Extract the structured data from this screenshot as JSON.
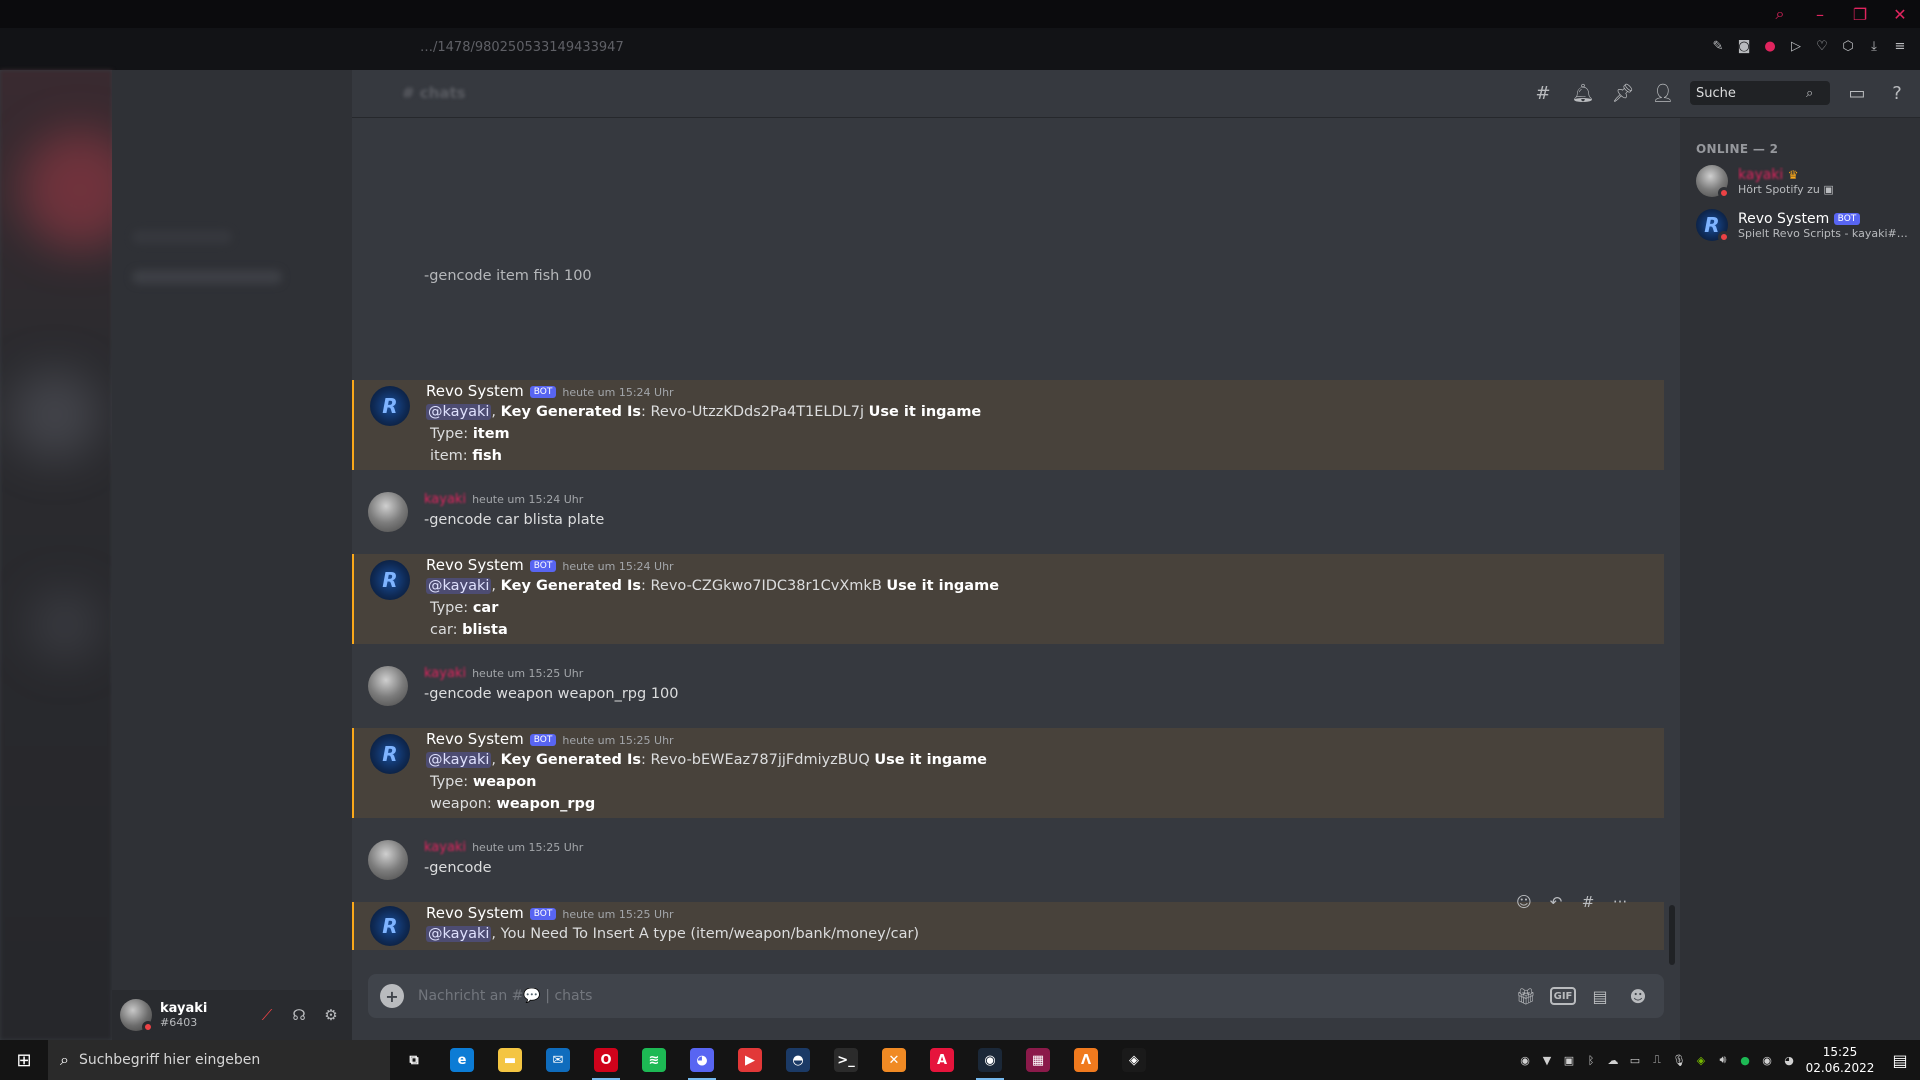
{
  "browser": {
    "url": "…/1478/980250533149433947",
    "window_controls": [
      "search-icon",
      "minimize-icon",
      "restore-icon",
      "close-icon"
    ],
    "toolbar_icons": [
      "edit-icon",
      "camera-icon",
      "record-icon",
      "play-icon",
      "heart-icon",
      "cube-icon",
      "download-icon",
      "menu-icon"
    ]
  },
  "header": {
    "channel_name": "# chats",
    "search_placeholder": "Suche"
  },
  "messages": [
    {
      "type": "continuation",
      "text": "-gencode item fish 100"
    },
    {
      "type": "bot",
      "author": "Revo System",
      "badge": "BOT",
      "timestamp": "heute um 15:24 Uhr",
      "mention": "@kayaki",
      "sep": ", ",
      "key_label": "Key Generated Is",
      "key_value": ": Revo-UtzzKDds2Pa4T1ELDL7j ",
      "suffix": "Use it ingame",
      "line2_label": "Type: ",
      "line2_value": "item",
      "line3_label": "item: ",
      "line3_value": "fish"
    },
    {
      "type": "user",
      "author": "kayaki",
      "timestamp": "heute um 15:24 Uhr",
      "text": "-gencode car blista plate"
    },
    {
      "type": "bot",
      "author": "Revo System",
      "badge": "BOT",
      "timestamp": "heute um 15:24 Uhr",
      "mention": "@kayaki",
      "sep": ", ",
      "key_label": "Key Generated Is",
      "key_value": ": Revo-CZGkwo7IDC38r1CvXmkB ",
      "suffix": "Use it ingame",
      "line2_label": "Type: ",
      "line2_value": "car",
      "line3_label": "car: ",
      "line3_value": "blista"
    },
    {
      "type": "user",
      "author": "kayaki",
      "timestamp": "heute um 15:25 Uhr",
      "text": "-gencode weapon weapon_rpg 100"
    },
    {
      "type": "bot",
      "author": "Revo System",
      "badge": "BOT",
      "timestamp": "heute um 15:25 Uhr",
      "mention": "@kayaki",
      "sep": ", ",
      "key_label": "Key Generated Is",
      "key_value": ": Revo-bEWEaz787jjFdmiyzBUQ ",
      "suffix": "Use it ingame",
      "line2_label": "Type: ",
      "line2_value": "weapon",
      "line3_label": "weapon: ",
      "line3_value": "weapon_rpg"
    },
    {
      "type": "user",
      "author": "kayaki",
      "timestamp": "heute um 15:25 Uhr",
      "text": "-gencode"
    },
    {
      "type": "bot",
      "author": "Revo System",
      "badge": "BOT",
      "timestamp": "heute um 15:25 Uhr",
      "mention": "@kayaki",
      "text": ", You Need To Insert A type (item/weapon/bank/money/car)"
    }
  ],
  "message_toolbar": [
    "add-reaction-icon",
    "reply-icon",
    "thread-icon",
    "more-icon"
  ],
  "composer": {
    "placeholder": "Nachricht an #💬 | chats",
    "icons": [
      "gift-icon",
      "gif-icon",
      "sticker-icon",
      "emoji-icon"
    ],
    "gif_label": "GIF"
  },
  "members": {
    "header": "ONLINE — 2",
    "list": [
      {
        "name": "kayaki",
        "activity": "Hört Spotify zu",
        "color": "#e0245e",
        "owner": true,
        "bot": false
      },
      {
        "name": "Revo System",
        "activity": "Spielt Revo Scripts - kayaki#6…",
        "color": "#ffffff",
        "owner": false,
        "bot": true,
        "badge": "BOT"
      }
    ]
  },
  "user_panel": {
    "name": "kayaki",
    "tag": "#6403"
  },
  "taskbar": {
    "search_placeholder": "Suchbegriff hier eingeben",
    "apps": [
      {
        "name": "task-view",
        "color": "transparent",
        "glyph": "⧉"
      },
      {
        "name": "edge",
        "color": "#0c7cd5",
        "glyph": "e"
      },
      {
        "name": "file-explorer",
        "color": "#f4c542",
        "glyph": "▬"
      },
      {
        "name": "mail",
        "color": "#0f6cbd",
        "glyph": "✉"
      },
      {
        "name": "opera",
        "color": "#d0021b",
        "glyph": "O",
        "active": true
      },
      {
        "name": "spotify",
        "color": "#1db954",
        "glyph": "≋"
      },
      {
        "name": "discord",
        "color": "#5865f2",
        "glyph": "◕",
        "active": true
      },
      {
        "name": "media-player",
        "color": "#e23838",
        "glyph": "▶"
      },
      {
        "name": "app-blue",
        "color": "#1b3a66",
        "glyph": "◓"
      },
      {
        "name": "terminal",
        "color": "#2b2b2b",
        "glyph": ">_"
      },
      {
        "name": "xampp",
        "color": "#f08a24",
        "glyph": "✕"
      },
      {
        "name": "app-red",
        "color": "#e6143c",
        "glyph": "A"
      },
      {
        "name": "steam",
        "color": "#1b2838",
        "glyph": "◉",
        "active": true
      },
      {
        "name": "winrar",
        "color": "#8b1a4a",
        "glyph": "▦"
      },
      {
        "name": "app-orange",
        "color": "#f07a1e",
        "glyph": "Λ"
      },
      {
        "name": "nvidia",
        "color": "#1a1a1a",
        "glyph": "◈"
      }
    ],
    "time": "15:25",
    "date": "02.06.2022"
  }
}
